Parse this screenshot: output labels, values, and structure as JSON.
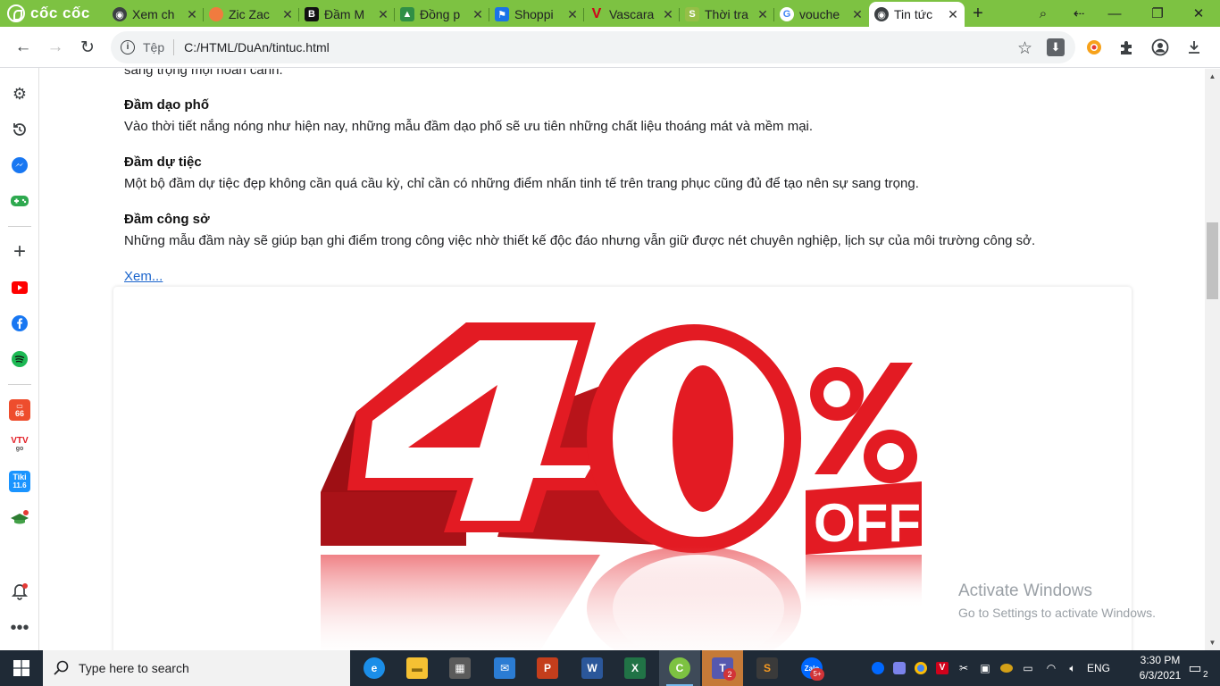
{
  "browser": {
    "brand": "cốc cốc",
    "tabs": [
      {
        "title": "Xem ch",
        "active": false,
        "icon": "globe-icon"
      },
      {
        "title": "Zic Zac",
        "active": false,
        "icon": "ziczac-icon"
      },
      {
        "title": "Đầm M",
        "active": false,
        "icon": "b-logo-icon"
      },
      {
        "title": "Đồng p",
        "active": false,
        "icon": "school-icon"
      },
      {
        "title": "Shoppi",
        "active": false,
        "icon": "flag-icon"
      },
      {
        "title": "Vascara",
        "active": false,
        "icon": "vascara-icon"
      },
      {
        "title": "Thời tra",
        "active": false,
        "icon": "shop-icon"
      },
      {
        "title": "vouche",
        "active": false,
        "icon": "google-icon"
      },
      {
        "title": "Tin tức",
        "active": true,
        "icon": "globe-icon"
      }
    ],
    "address": {
      "scheme_label": "Tệp",
      "url": "C:/HTML/DuAn/tintuc.html"
    }
  },
  "page": {
    "cut_text": "sang trọng mọi hoàn cảnh.",
    "sections": [
      {
        "heading": "Đầm dạo phố",
        "text": "Vào thời tiết nắng nóng như hiện nay, những mẫu đầm dạo phố sẽ ưu tiên những chất liệu thoáng mát và mềm mại."
      },
      {
        "heading": "Đầm dự tiệc",
        "text": "Một bộ đầm dự tiệc đẹp không cần quá cầu kỳ, chỉ cần có những điểm nhấn tinh tế trên trang phục cũng đủ để tạo nên sự sang trọng."
      },
      {
        "heading": "Đầm công sở",
        "text": "Những mẫu đầm này sẽ giúp bạn ghi điểm trong công việc nhờ thiết kế độc đáo nhưng vẫn giữ được nét chuyên nghiệp, lịch sự của môi trường công sở."
      }
    ],
    "more_link": "Xem...",
    "banner": {
      "big_text": "40",
      "percent": "%",
      "off": "OFF",
      "colors": {
        "red": "#e31b23",
        "dark_red": "#9e0f14",
        "white": "#ffffff"
      }
    },
    "watermark": {
      "line1": "Activate Windows",
      "line2": "Go to Settings to activate Windows."
    }
  },
  "sidebar": {
    "icons": [
      "gear-icon",
      "history-icon",
      "messenger-icon",
      "game-icon",
      "plus-icon",
      "youtube-icon",
      "facebook-icon",
      "spotify-icon",
      "shopee-icon",
      "vtv-icon",
      "tiki-icon",
      "hat-icon",
      "bell-icon",
      "more-icon"
    ],
    "labels": {
      "shopee": "66",
      "vtv": "VTV",
      "vtv_sub": "go",
      "tiki": "Tiki",
      "tiki_date": "11.6"
    }
  },
  "taskbar": {
    "search_placeholder": "Type here to search",
    "apps": [
      {
        "name": "edge",
        "label": "e",
        "color": "#1b8ee8"
      },
      {
        "name": "file-explorer",
        "label": "▬",
        "color": "#f5c133"
      },
      {
        "name": "store",
        "label": "▦",
        "color": "#5b5b5b"
      },
      {
        "name": "mail",
        "label": "✉",
        "color": "#2b7cd3"
      },
      {
        "name": "powerpoint",
        "label": "P",
        "color": "#c43e1c"
      },
      {
        "name": "word",
        "label": "W",
        "color": "#2b579a"
      },
      {
        "name": "excel",
        "label": "X",
        "color": "#217346"
      },
      {
        "name": "coccoc",
        "label": "C",
        "color": "#7dc242"
      },
      {
        "name": "teams",
        "label": "T",
        "color": "#5558af",
        "badge": "2"
      },
      {
        "name": "sublime",
        "label": "S",
        "color": "#f79a21"
      },
      {
        "name": "zalo",
        "label": "Zalo",
        "color": "#0068ff",
        "badge": "5+"
      }
    ],
    "language": "ENG",
    "time": "3:30 PM",
    "date": "6/3/2021",
    "notification_count": "2"
  }
}
